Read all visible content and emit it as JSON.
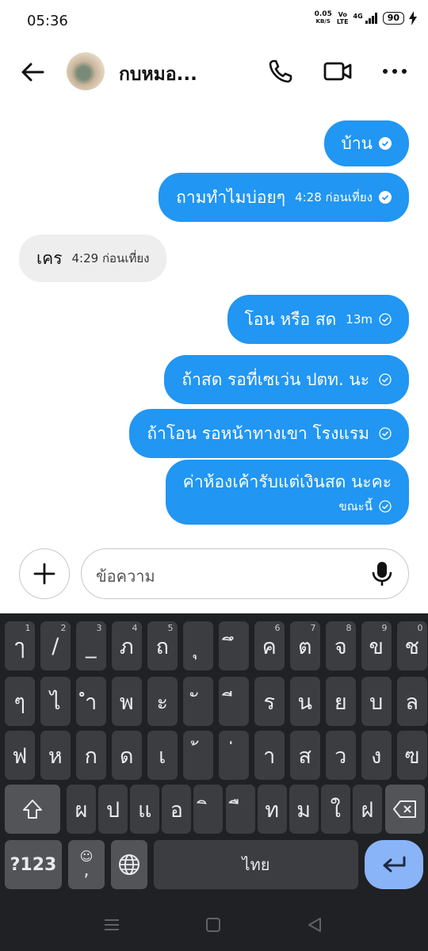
{
  "status_bar": {
    "time": "05:36",
    "speed_value": "0.05",
    "speed_unit": "KB/S",
    "volte_top": "Vo",
    "volte_bottom": "LTE",
    "network": "4G",
    "battery": "90"
  },
  "header": {
    "contact_name": "กบหมอ..."
  },
  "messages": [
    {
      "text": "บ้าน",
      "time": "",
      "direction": "out",
      "status": "read"
    },
    {
      "text": "ถามทำไมบ่อยๆ",
      "time": "4:28 ก่อนเที่ยง",
      "direction": "out",
      "status": "read"
    },
    {
      "text": "เคร",
      "time": "4:29 ก่อนเที่ยง",
      "direction": "in"
    },
    {
      "text": "โอน หรือ สด",
      "time": "13m",
      "direction": "out",
      "status": "sent"
    },
    {
      "text": "ถ้าสด รอที่เซเว่น ปตท. นะ",
      "time": "",
      "direction": "out",
      "status": "sent"
    },
    {
      "text": "ถ้าโอน รอหน้าทางเขา โรงแรม",
      "time": "",
      "direction": "out",
      "status": "sent"
    },
    {
      "text": "ค่าห้องเค้ารับแต่เงินสด นะคะ",
      "time": "ขณะนี้",
      "direction": "out",
      "status": "sent"
    }
  ],
  "composer": {
    "placeholder": "ข้อความ"
  },
  "keyboard": {
    "row1": [
      {
        "label": "ๅ",
        "hint": "1"
      },
      {
        "label": "/",
        "hint": "2"
      },
      {
        "label": "_",
        "hint": "3"
      },
      {
        "label": "ภ",
        "hint": "4"
      },
      {
        "label": "ถ",
        "hint": "5"
      },
      {
        "label": "ุ",
        "hint": ""
      },
      {
        "label": "ึ",
        "hint": ""
      },
      {
        "label": "ค",
        "hint": "6"
      },
      {
        "label": "ต",
        "hint": "7"
      },
      {
        "label": "จ",
        "hint": "8"
      },
      {
        "label": "ข",
        "hint": "9"
      },
      {
        "label": "ช",
        "hint": "0"
      }
    ],
    "row2": [
      "ๆ",
      "ไ",
      "ำ",
      "พ",
      "ะ",
      "ั",
      "ี",
      "ร",
      "น",
      "ย",
      "บ",
      "ล"
    ],
    "row3": [
      "ฟ",
      "ห",
      "ก",
      "ด",
      "เ",
      "้",
      "่",
      "า",
      "ส",
      "ว",
      "ง",
      "ฃ"
    ],
    "row4": [
      "ผ",
      "ป",
      "แ",
      "อ",
      "ิ",
      "ื",
      "ท",
      "ม",
      "ใ",
      "ฝ"
    ],
    "symbols_label": "?123",
    "emoji_label": "☺",
    "comma_label": ",",
    "space_label": "ไทย"
  },
  "colors": {
    "outgoing_bubble": "#2196f3",
    "incoming_bubble": "#eeeeef",
    "keyboard_bg": "#202124",
    "key_bg": "#3c3d40",
    "enter_key": "#8ab4f8"
  }
}
